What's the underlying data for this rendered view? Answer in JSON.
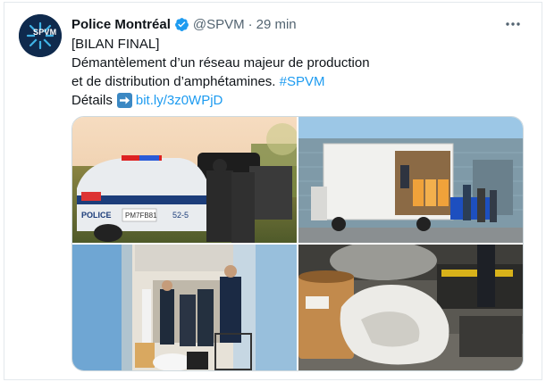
{
  "tweet": {
    "author_name": "Police Montréal",
    "handle": "@SPVM",
    "separator": "·",
    "time": "29 min",
    "avatar_text": "SPVM",
    "lines": [
      "[BILAN FINAL]",
      "Démantèlement d’un réseau majeur de production",
      "et de distribution d’amphétamines."
    ],
    "hashtag": "#SPVM",
    "details_label": "Détails",
    "link": "bit.ly/3z0WPjD"
  },
  "media": {
    "car_plate": "PM7FB81",
    "car_unit": "52-5",
    "car_text": "POLICE"
  },
  "icons": {
    "verified": "verified-badge-icon",
    "more": "more-dots-icon",
    "arrow": "right-arrow-emoji-icon"
  },
  "colors": {
    "link": "#1d9bf0",
    "text": "#0f1419",
    "muted": "#536471",
    "avatar_bg": "#0f2a4d"
  }
}
